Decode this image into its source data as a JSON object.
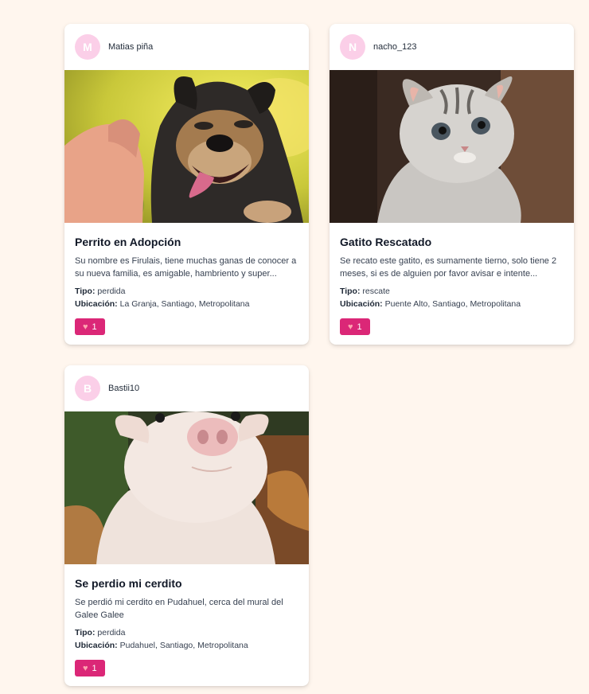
{
  "posts": [
    {
      "avatar_letter": "M",
      "username": "Matias piña",
      "title": "Perrito en Adopción",
      "description": "Su nombre es Firulais, tiene muchas ganas de conocer a su nueva familia, es amigable, hambriento y super...",
      "type_label": "Tipo:",
      "type": "perdida",
      "location_label": "Ubicación:",
      "location": "La Granja, Santiago, Metropolitana",
      "likes": "1",
      "image": "dog-photo"
    },
    {
      "avatar_letter": "N",
      "username": "nacho_123",
      "title": "Gatito Rescatado",
      "description": "Se recato este gatito, es sumamente tierno, solo tiene 2 meses, si es de alguien por favor avisar e intente...",
      "type_label": "Tipo:",
      "type": "rescate",
      "location_label": "Ubicación:",
      "location": "Puente Alto, Santiago, Metropolitana",
      "likes": "1",
      "image": "kitten-photo"
    },
    {
      "avatar_letter": "B",
      "username": "Bastii10",
      "title": "Se perdio mi cerdito",
      "description": "Se perdió mi cerdito en Pudahuel, cerca del mural del Galee Galee",
      "type_label": "Tipo:",
      "type": "perdida",
      "location_label": "Ubicación:",
      "location": "Pudahuel, Santiago, Metropolitana",
      "likes": "1",
      "image": "pig-photo"
    }
  ],
  "colors": {
    "background": "#fff6ee",
    "avatar": "#fbcfe8",
    "like_button": "#db2777"
  },
  "icons": {
    "like": "heart-icon"
  }
}
